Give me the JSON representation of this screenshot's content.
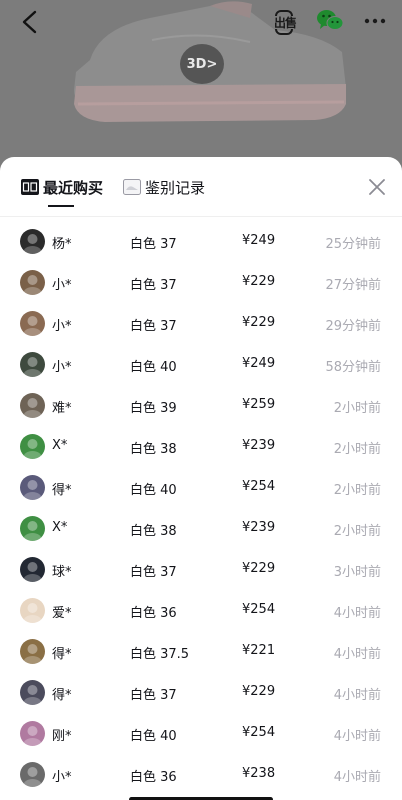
{
  "header": {
    "back_icon": "chevron-left-icon",
    "sell_label": "出售",
    "wechat_icon": "wechat-icon",
    "more_icon": "more-icon",
    "view3d_label": "3D>"
  },
  "sheet": {
    "tabs": [
      {
        "label": "最近购买",
        "icon": "recent-purchase-icon",
        "active": true
      },
      {
        "label": "鉴别记录",
        "icon": "identify-record-icon",
        "active": false
      }
    ],
    "close_icon": "close-icon"
  },
  "purchases": [
    {
      "name": "杨*",
      "spec": "白色 37",
      "price": "¥249",
      "time": "25分钟前",
      "avatar_color": "#2b2b2b"
    },
    {
      "name": "小*",
      "spec": "白色 37",
      "price": "¥229",
      "time": "27分钟前",
      "avatar_color": "#7a6048"
    },
    {
      "name": "小*",
      "spec": "白色 37",
      "price": "¥229",
      "time": "29分钟前",
      "avatar_color": "#8a6a52"
    },
    {
      "name": "小*",
      "spec": "白色 40",
      "price": "¥249",
      "time": "58分钟前",
      "avatar_color": "#3e4a3e"
    },
    {
      "name": "难*",
      "spec": "白色 39",
      "price": "¥259",
      "time": "2小时前",
      "avatar_color": "#6e6356"
    },
    {
      "name": "X*",
      "spec": "白色 38",
      "price": "¥239",
      "time": "2小时前",
      "avatar_color": "#3f8f43"
    },
    {
      "name": "得*",
      "spec": "白色 40",
      "price": "¥254",
      "time": "2小时前",
      "avatar_color": "#5a5a7a"
    },
    {
      "name": "X*",
      "spec": "白色 38",
      "price": "¥239",
      "time": "2小时前",
      "avatar_color": "#3f8f43"
    },
    {
      "name": "球*",
      "spec": "白色 37",
      "price": "¥229",
      "time": "3小时前",
      "avatar_color": "#222833"
    },
    {
      "name": "爱*",
      "spec": "白色 36",
      "price": "¥254",
      "time": "4小时前",
      "avatar_color": "#e8d6c2"
    },
    {
      "name": "得*",
      "spec": "白色 37.5",
      "price": "¥221",
      "time": "4小时前",
      "avatar_color": "#8a6f45"
    },
    {
      "name": "得*",
      "spec": "白色 37",
      "price": "¥229",
      "time": "4小时前",
      "avatar_color": "#4b4b5c"
    },
    {
      "name": "刚*",
      "spec": "白色 40",
      "price": "¥254",
      "time": "4小时前",
      "avatar_color": "#b07aa0"
    },
    {
      "name": "小*",
      "spec": "白色 36",
      "price": "¥238",
      "time": "4小时前",
      "avatar_color": "#6a6a6a"
    }
  ]
}
